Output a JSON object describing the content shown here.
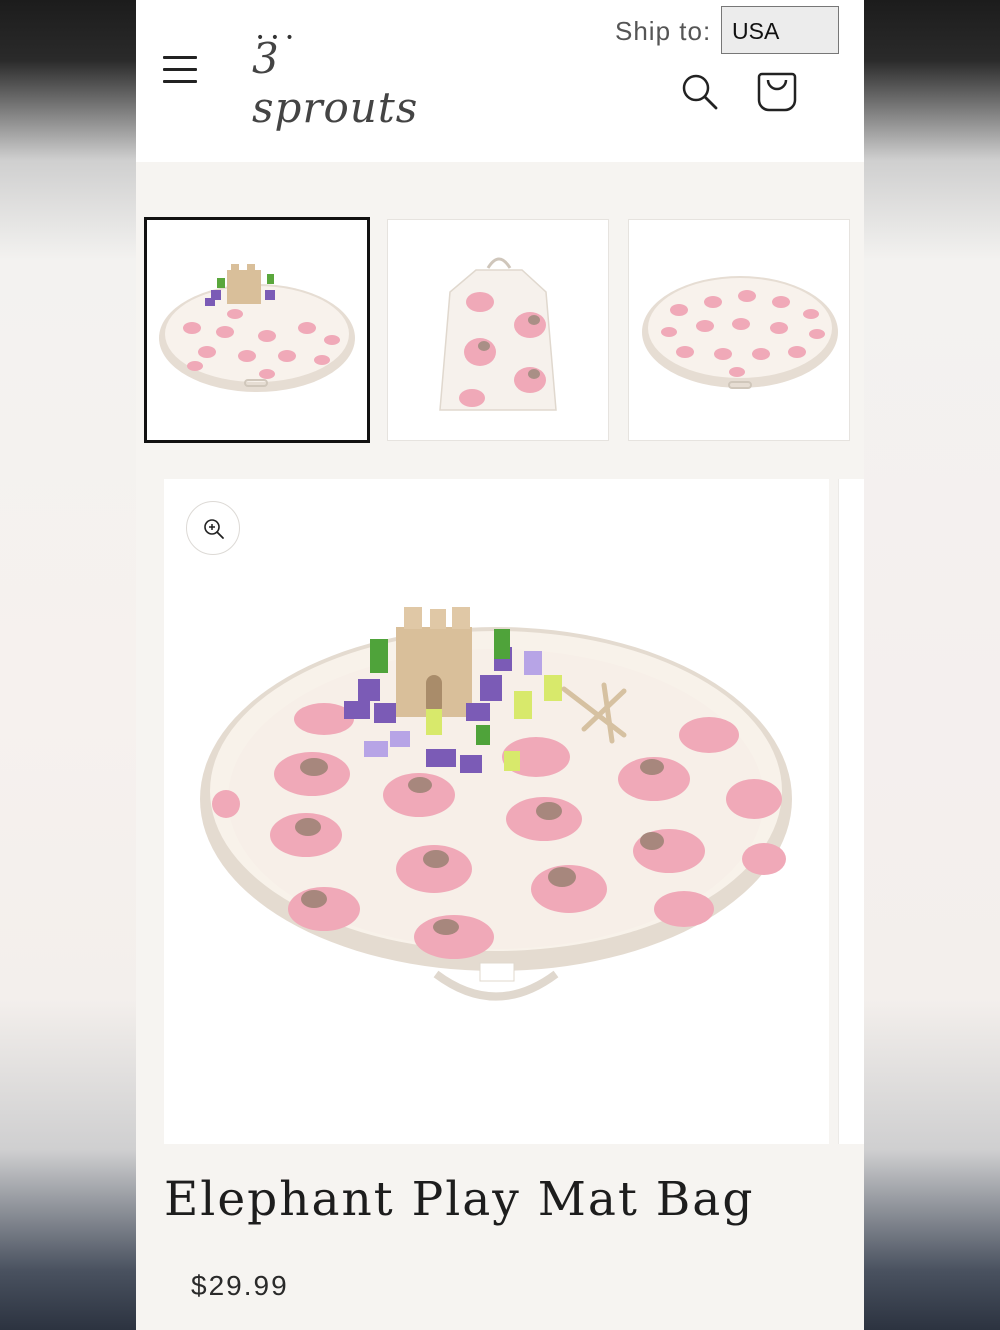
{
  "header": {
    "logo_number": "3",
    "logo_word": "sprouts",
    "ship_to_label": "Ship to:",
    "country_selected": "USA"
  },
  "gallery": {
    "thumbnails": [
      {
        "alt": "Elephant play mat with toys",
        "selected": true
      },
      {
        "alt": "Elephant play mat as bag",
        "selected": false
      },
      {
        "alt": "Elephant play mat flat",
        "selected": false
      }
    ]
  },
  "product": {
    "title": "Elephant Play Mat Bag",
    "price": "$29.99"
  },
  "colors": {
    "mat_pink": "#f0a9b8",
    "mat_cream": "#f7efe8",
    "rim": "#e8e1d8"
  },
  "icons": [
    "menu-icon",
    "search-icon",
    "cart-icon",
    "zoom-in-icon"
  ]
}
